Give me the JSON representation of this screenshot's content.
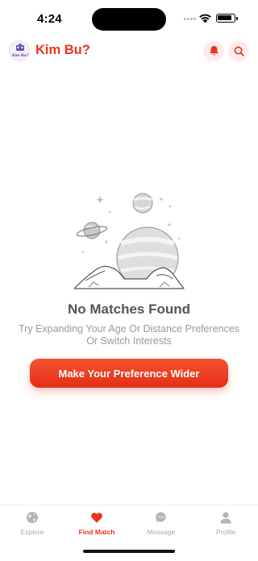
{
  "status_bar": {
    "time": "4:24"
  },
  "header": {
    "logo_text": "Kim Bu?",
    "brand_title": "Kim Bu?",
    "icons": [
      "bell-icon",
      "search-icon"
    ],
    "accent_color": "#e8351f"
  },
  "empty_state": {
    "title": "No Matches Found",
    "subtitle": "Try Expanding Your Age Or Distance Preferences Or Switch Interests",
    "button_label": "Make Your Preference Wider"
  },
  "bottom_nav": {
    "items": [
      {
        "label": "Explore",
        "icon": "globe-icon"
      },
      {
        "label": "Find Match",
        "icon": "heart-icon",
        "active": true
      },
      {
        "label": "Message",
        "icon": "chat-icon"
      },
      {
        "label": "Profile",
        "icon": "user-icon"
      }
    ]
  }
}
